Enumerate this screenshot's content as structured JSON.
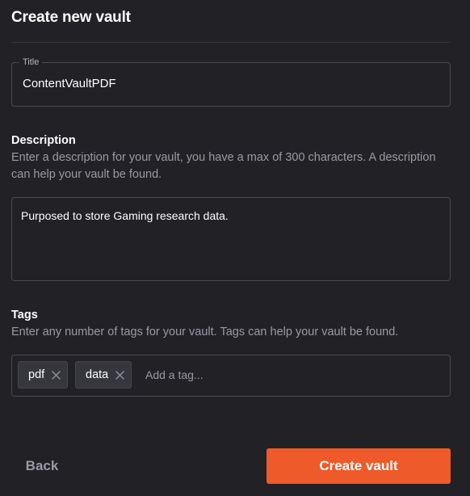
{
  "dialog": {
    "title": "Create new vault"
  },
  "title_field": {
    "label": "Title",
    "value": "ContentVaultPDF"
  },
  "description": {
    "heading": "Description",
    "help": "Enter a description for your vault, you have a max of 300 characters. A description can help your vault be found.",
    "value": "Purposed to store Gaming research data."
  },
  "tags": {
    "heading": "Tags",
    "help": "Enter any number of tags for your vault. Tags can help your vault be found.",
    "items": [
      {
        "label": "pdf",
        "remove_icon": "close-icon"
      },
      {
        "label": "data",
        "remove_icon": "close-icon"
      }
    ],
    "placeholder": "Add a tag..."
  },
  "actions": {
    "back_label": "Back",
    "create_label": "Create vault"
  },
  "colors": {
    "background": "#212126",
    "accent": "#ee5a29",
    "border": "#4a4a50",
    "muted_text": "#9a9aa2"
  }
}
